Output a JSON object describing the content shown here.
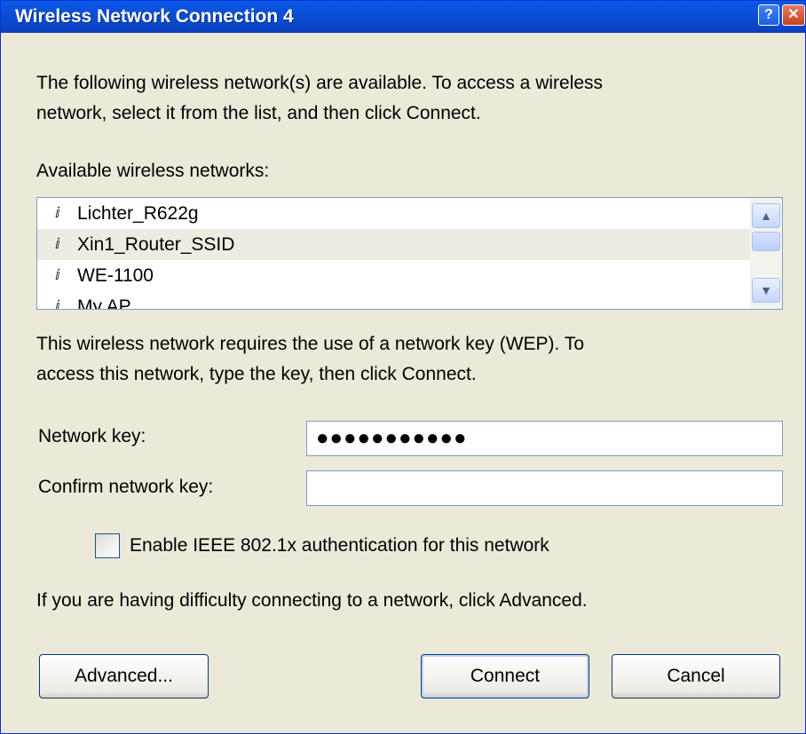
{
  "window": {
    "title": "Wireless Network Connection 4",
    "help_glyph": "?",
    "close_glyph": "✕"
  },
  "intro_text": {
    "line1": "The following wireless network(s) are available. To access a wireless",
    "line2": "network, select it from the list, and then click Connect."
  },
  "networks_label": "Available wireless networks:",
  "networks": [
    {
      "name": "Lichter_R622g",
      "selected": false
    },
    {
      "name": "Xin1_Router_SSID",
      "selected": true
    },
    {
      "name": "WE-1100",
      "selected": false
    },
    {
      "name": "My AP",
      "selected": false
    }
  ],
  "wep_text": {
    "line1": "This wireless network requires the use of a network key (WEP). To",
    "line2": "access this network, type the key, then click Connect."
  },
  "network_key": {
    "label": "Network key:",
    "value": "●●●●●●●●●●●"
  },
  "confirm_key": {
    "label": "Confirm network key:",
    "value": ""
  },
  "ieee_checkbox": {
    "label": "Enable IEEE 802.1x authentication for this network",
    "checked": false
  },
  "advanced_hint": "If you are having difficulty connecting to a network, click Advanced.",
  "buttons": {
    "advanced": "Advanced...",
    "connect": "Connect",
    "cancel": "Cancel"
  },
  "icons": {
    "network": "antenna-icon",
    "scroll_up": "scroll-up-icon",
    "scroll_down": "scroll-down-icon"
  },
  "colors": {
    "titlebar": "#0a4fd4",
    "dialog_bg": "#ece9d8",
    "selected_row": "#eeebe2"
  }
}
